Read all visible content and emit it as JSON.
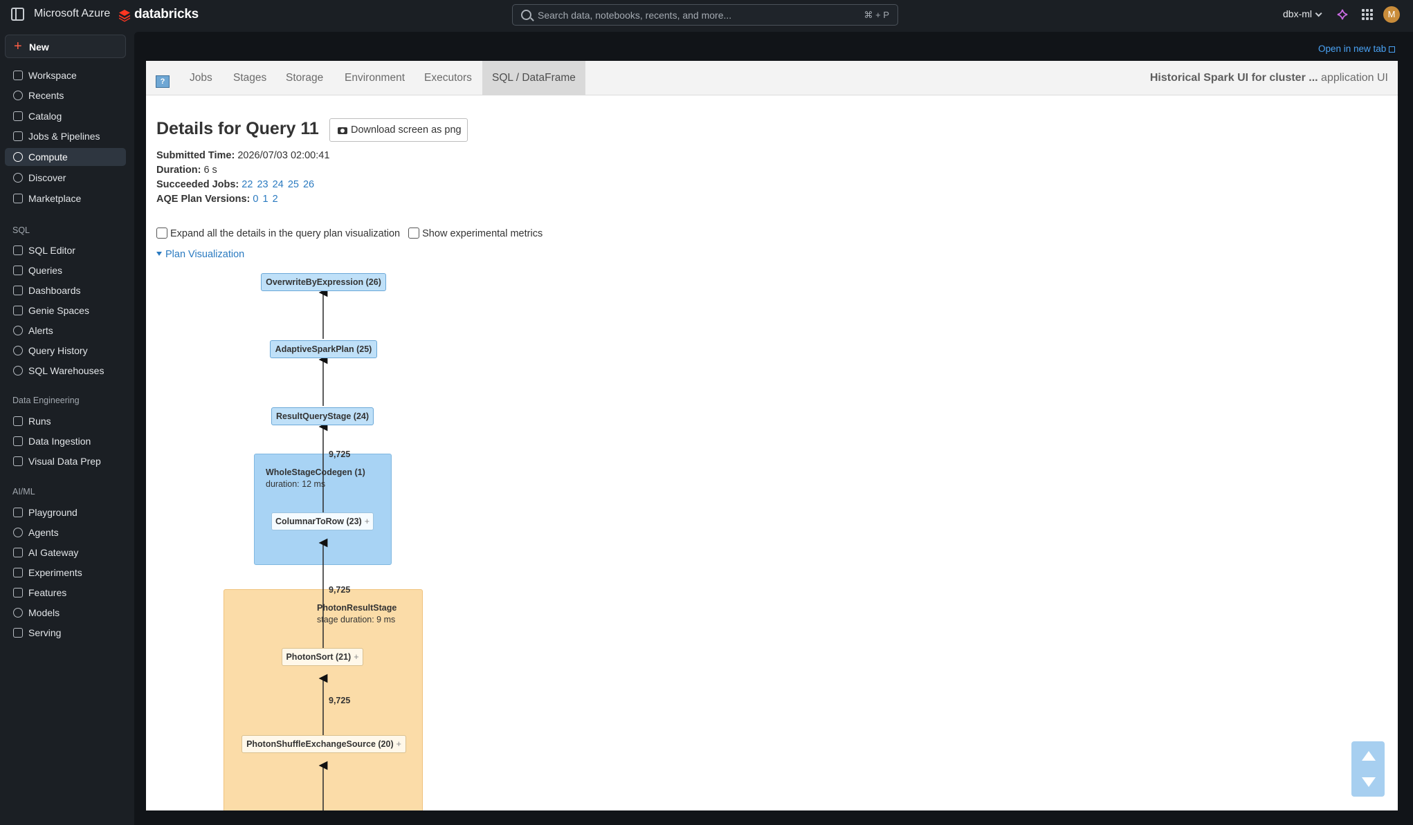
{
  "topbar": {
    "brand": "Microsoft Azure",
    "product": "databricks",
    "search_placeholder": "Search data, notebooks, recents, and more...",
    "search_shortcut": "⌘ + P",
    "workspace": "dbx-ml",
    "avatar_initial": "M"
  },
  "sidebar": {
    "new_label": "New",
    "items": [
      {
        "label": "Workspace"
      },
      {
        "label": "Recents"
      },
      {
        "label": "Catalog"
      },
      {
        "label": "Jobs & Pipelines"
      },
      {
        "label": "Compute"
      },
      {
        "label": "Discover"
      },
      {
        "label": "Marketplace"
      }
    ],
    "sql_section": "SQL",
    "sql_items": [
      {
        "label": "SQL Editor"
      },
      {
        "label": "Queries"
      },
      {
        "label": "Dashboards"
      },
      {
        "label": "Genie Spaces"
      },
      {
        "label": "Alerts"
      },
      {
        "label": "Query History"
      },
      {
        "label": "SQL Warehouses"
      }
    ],
    "de_section": "Data Engineering",
    "de_items": [
      {
        "label": "Runs"
      },
      {
        "label": "Data Ingestion"
      },
      {
        "label": "Visual Data Prep"
      }
    ],
    "ml_section": "AI/ML",
    "ml_items": [
      {
        "label": "Playground"
      },
      {
        "label": "Agents"
      },
      {
        "label": "AI Gateway"
      },
      {
        "label": "Experiments"
      },
      {
        "label": "Features"
      },
      {
        "label": "Models"
      },
      {
        "label": "Serving"
      }
    ]
  },
  "main": {
    "open_new_tab": "Open in new tab"
  },
  "spark": {
    "logo_text": "?",
    "tabs": [
      {
        "label": "Jobs"
      },
      {
        "label": "Stages"
      },
      {
        "label": "Storage"
      },
      {
        "label": "Environment"
      },
      {
        "label": "Executors"
      },
      {
        "label": "SQL / DataFrame"
      }
    ],
    "active_tab": "SQL / DataFrame",
    "title_bold": "Historical Spark UI for cluster ...",
    "title_rest": "application UI"
  },
  "query": {
    "title": "Details for Query 11",
    "download_label": "Download screen as png",
    "submitted_label": "Submitted Time:",
    "submitted_value": "2026/07/03 02:00:41",
    "duration_label": "Duration:",
    "duration_value": "6 s",
    "jobs_label": "Succeeded Jobs:",
    "jobs": [
      "22",
      "23",
      "24",
      "25",
      "26"
    ],
    "aqe_label": "AQE Plan Versions:",
    "aqe_versions": [
      "0",
      "1",
      "2"
    ],
    "expand_label": "Expand all the details in the query plan visualization",
    "experimental_label": "Show experimental metrics",
    "plan_link": "Plan Visualization"
  },
  "plan": {
    "nodes": {
      "overwrite": "OverwriteByExpression (26)",
      "adaptive": "AdaptiveSparkPlan (25)",
      "result_stage": "ResultQueryStage (24)",
      "columnar": "ColumnarToRow (23)",
      "photon_sort": "PhotonSort (21)",
      "shuffle_source": "PhotonShuffleExchangeSource (20)"
    },
    "expand_glyph": "+",
    "wsc": {
      "title": "WholeStageCodegen (1)",
      "sub": "duration: 12 ms"
    },
    "photon": {
      "title": "PhotonResultStage",
      "sub": "stage duration: 9 ms"
    },
    "edge_labels": [
      "9,725",
      "9,725",
      "9,725"
    ]
  },
  "colors": {
    "accent_new": "#ff5f46",
    "link": "#2a7ac0",
    "cluster_blue": "#a8d3f4",
    "cluster_orange": "#fbdca8"
  }
}
